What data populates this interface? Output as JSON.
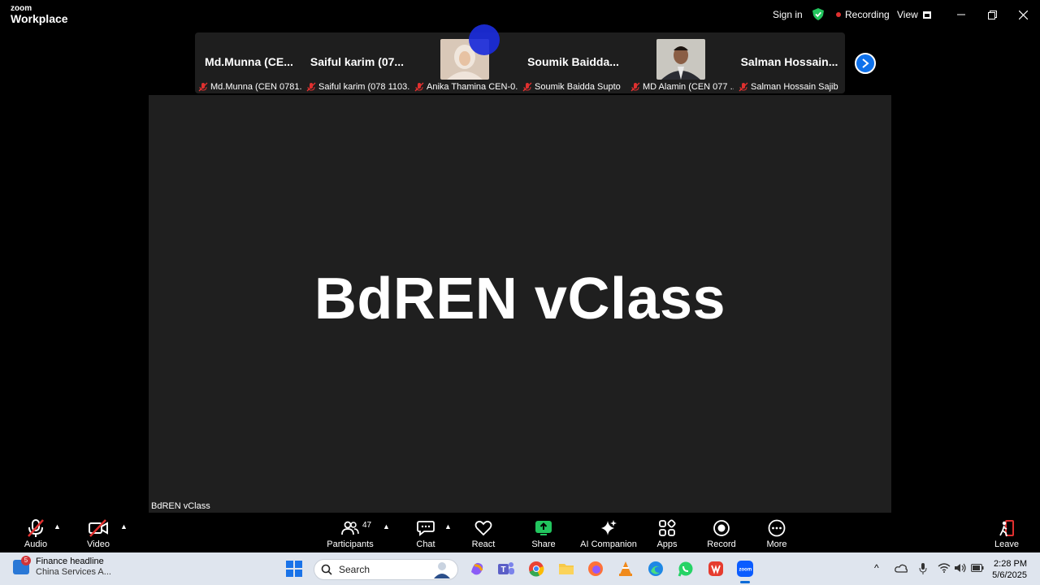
{
  "app": {
    "brand_small": "zoom",
    "brand_big": "Workplace"
  },
  "titlebar": {
    "signin": "Sign in",
    "recording": "Recording",
    "view": "View"
  },
  "participants_strip": [
    {
      "display": "Md.Munna (CE...",
      "caption": "Md.Munna (CEN 0781...",
      "has_video": false
    },
    {
      "display": "Saiful karim (07...",
      "caption": "Saiful karim (078 1103...",
      "has_video": false
    },
    {
      "display": "",
      "caption": "Anika Thamina CEN-0...",
      "has_video": true
    },
    {
      "display": "Soumik Baidda...",
      "caption": "Soumik Baidda Supto",
      "has_video": false
    },
    {
      "display": "",
      "caption": "MD Alamin (CEN 077 ...",
      "has_video": true
    },
    {
      "display": "Salman Hossain...",
      "caption": "Salman Hossain Sajib",
      "has_video": false
    }
  ],
  "stage": {
    "title": "BdREN vClass",
    "label": "BdREN vClass"
  },
  "toolbar": {
    "audio": "Audio",
    "video": "Video",
    "participants": "Participants",
    "participants_count": "47",
    "chat": "Chat",
    "react": "React",
    "share": "Share",
    "ai_companion": "AI Companion",
    "apps": "Apps",
    "record": "Record",
    "more": "More",
    "leave": "Leave"
  },
  "taskbar": {
    "news_title": "Finance headline",
    "news_sub": "China Services A...",
    "news_badge": "5",
    "search": "Search",
    "time": "2:28 PM",
    "date": "5/6/2025"
  },
  "colors": {
    "accent": "#0e71eb",
    "share": "#22c55e",
    "recording": "#e0302f",
    "stage_bg": "#1f1f1f"
  }
}
